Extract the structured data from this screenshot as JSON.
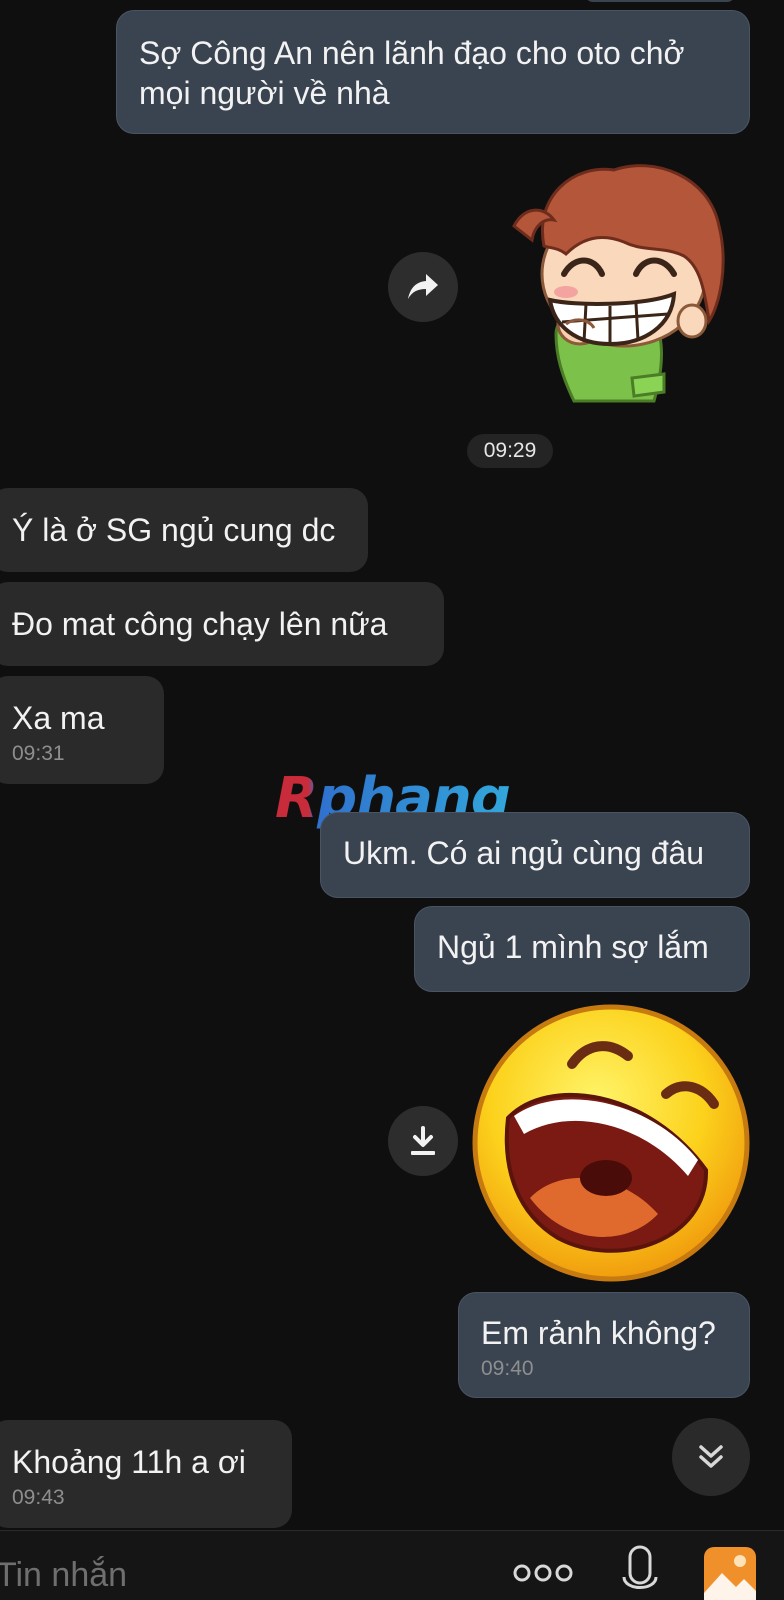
{
  "messages": {
    "m1": {
      "text_line1": "Sợ Công An nên lãnh đạo cho oto chở",
      "text_line2": "mọi người về nhà"
    },
    "date_chip": "09:29",
    "m2": {
      "text": "Ý là ở SG ngủ cung dc"
    },
    "m3": {
      "text": "Đo mat công chạy lên nữa"
    },
    "m4": {
      "text": "Xa ma",
      "time": "09:31"
    },
    "m5": {
      "text": "Ukm. Có ai ngủ cùng đâu"
    },
    "m6": {
      "text": "Ngủ 1 mình sợ lắm"
    },
    "m7": {
      "text": "Em rảnh không?",
      "time": "09:40"
    },
    "m8": {
      "text": "Khoảng 11h a ơi",
      "time": "09:43"
    }
  },
  "watermark": "Rphang",
  "composer": {
    "placeholder": "Tin nhắn"
  },
  "icons": {
    "share": "share-arrow-icon",
    "download": "download-icon",
    "scroll_down": "double-chevron-down-icon",
    "more": "more-dots-icon",
    "mic": "microphone-icon",
    "gallery": "gallery-image-icon"
  },
  "colors": {
    "background": "#0f0f0f",
    "outgoing_bubble": "#3a4451",
    "incoming_bubble": "#2a2a2a",
    "timestamp": "#8e8e8e",
    "gallery_icon": "#f0902a"
  }
}
